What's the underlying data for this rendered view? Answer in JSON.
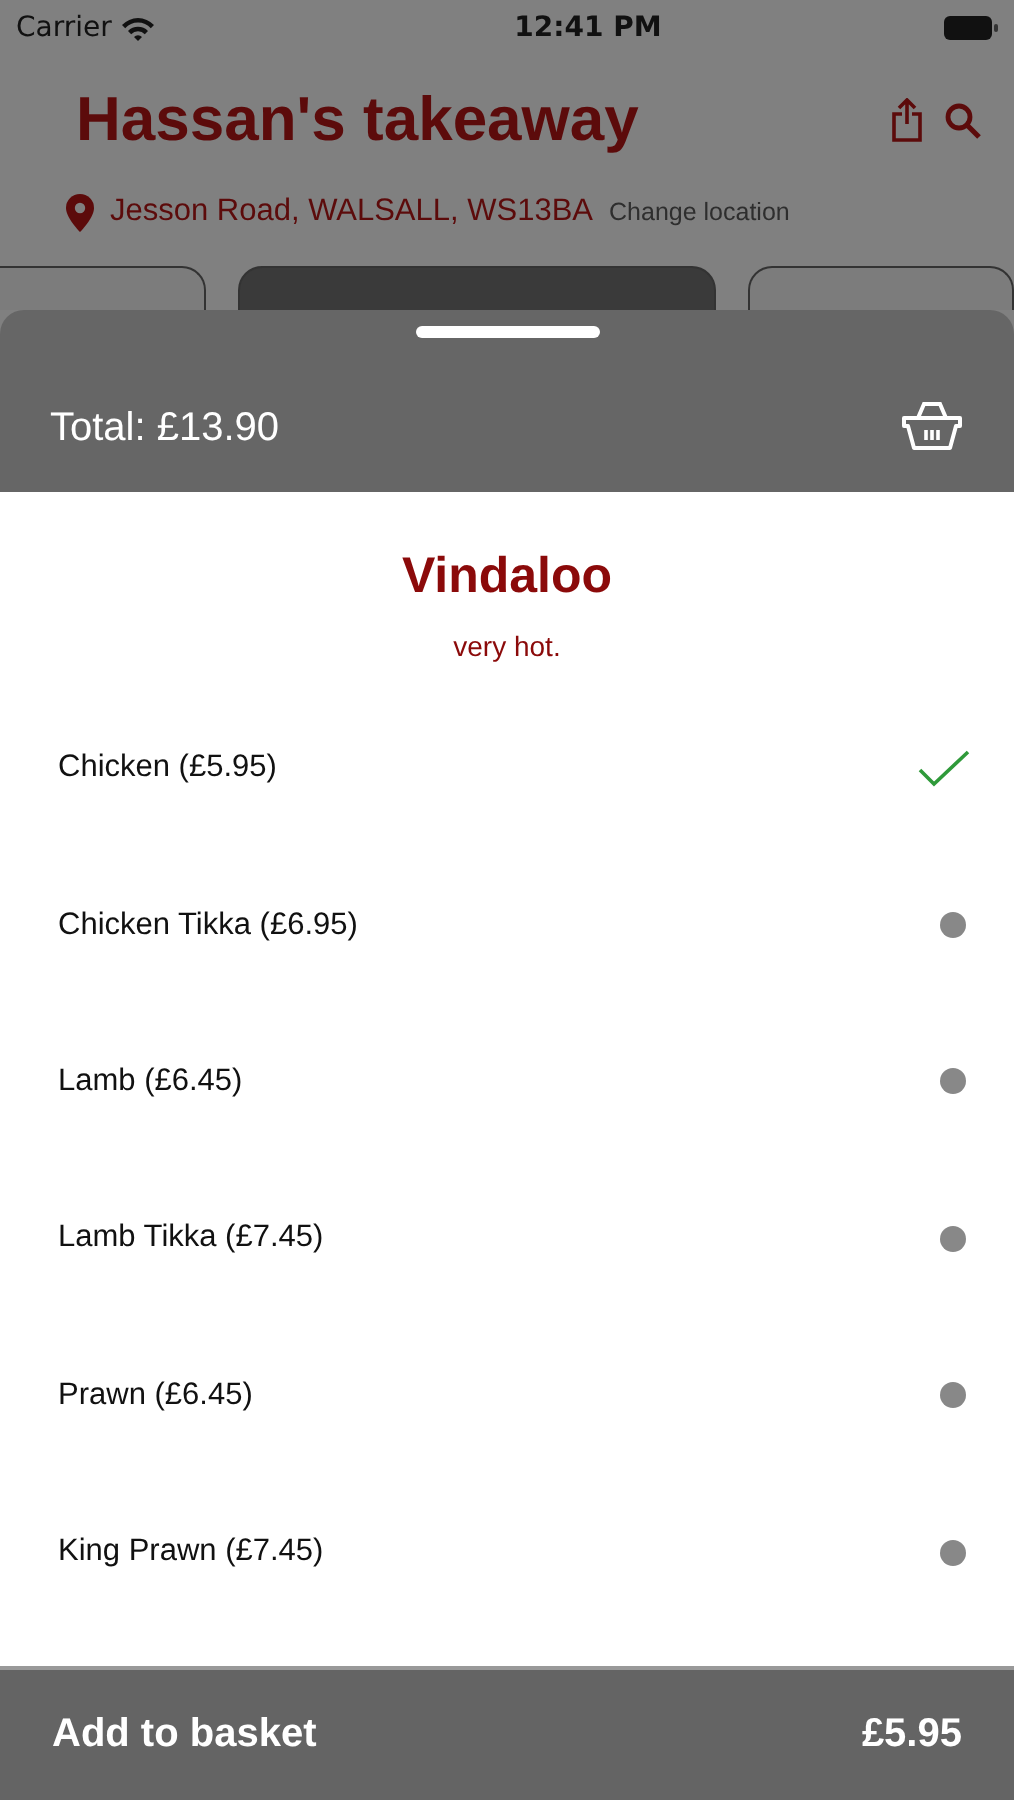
{
  "status_bar": {
    "carrier": "Carrier",
    "time": "12:41 PM"
  },
  "header": {
    "title": "Hassan's takeaway",
    "address": "Jesson Road, WALSALL, WS13BA",
    "change_location": "Change location"
  },
  "category_tabs": [
    {
      "selected": false
    },
    {
      "selected": true
    },
    {
      "selected": false
    }
  ],
  "sheet": {
    "total": "Total: £13.90",
    "dish": {
      "name": "Vindaloo",
      "description": "very hot."
    },
    "options": [
      {
        "label": "Chicken (£5.95)",
        "selected": true
      },
      {
        "label": "Chicken Tikka (£6.95)",
        "selected": false
      },
      {
        "label": "Lamb (£6.45)",
        "selected": false
      },
      {
        "label": "Lamb Tikka (£7.45)",
        "selected": false
      },
      {
        "label": "Prawn (£6.45)",
        "selected": false
      },
      {
        "label": "King Prawn (£7.45)",
        "selected": false
      }
    ],
    "add_button": {
      "label": "Add to basket",
      "price": "£5.95"
    }
  }
}
